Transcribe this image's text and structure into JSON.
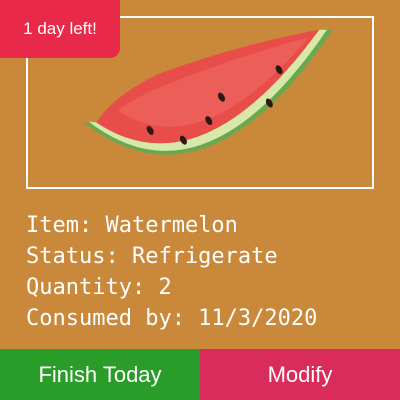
{
  "badge": {
    "text": "1 day left!"
  },
  "item": {
    "image_icon": "watermelon-slice-icon",
    "lines": [
      "Item: Watermelon",
      "Status: Refrigerate",
      "Quantity: 2",
      "Consumed by: 11/3/2020"
    ]
  },
  "actions": {
    "finish_label": "Finish Today",
    "modify_label": "Modify"
  },
  "colors": {
    "card_background": "#c9883a",
    "badge": "#e8294a",
    "finish_button": "#2a9c2a",
    "modify_button": "#d92b5c",
    "text": "#ffffff"
  }
}
